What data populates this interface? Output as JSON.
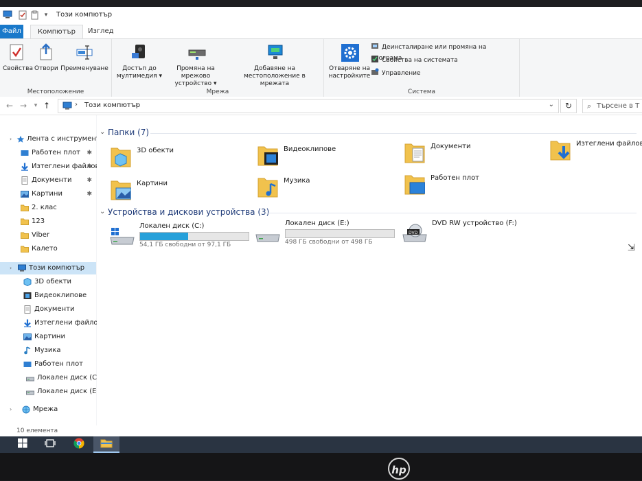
{
  "window": {
    "title": "Този компютър",
    "quick_access_icons": [
      "computer-icon",
      "properties-icon",
      "checkmark-icon",
      "dropdown-icon"
    ]
  },
  "ribbon_tabs": [
    {
      "label": "Файл",
      "state": "file"
    },
    {
      "label": "Компютър",
      "state": "active"
    },
    {
      "label": "Изглед",
      "state": "normal"
    }
  ],
  "ribbon": {
    "location_group": {
      "label": "Местоположение",
      "buttons": [
        {
          "label": "Свойства",
          "icon": "properties-icon"
        },
        {
          "label": "Отвори",
          "icon": "open-icon"
        },
        {
          "label": "Преименуване",
          "icon": "rename-icon"
        }
      ]
    },
    "network_group": {
      "label": "Мрежа",
      "buttons": [
        {
          "label_line1": "Достъп до",
          "label_line2": "мултимедия ▾",
          "icon": "media-access-icon"
        },
        {
          "label_line1": "Промяна на мрежово",
          "label_line2": "устройство ▾",
          "icon": "network-drive-icon"
        },
        {
          "label_line1": "Добавяне на",
          "label_line2": "местоположение в мрежата",
          "icon": "network-location-icon"
        }
      ]
    },
    "system_group": {
      "label": "Система",
      "open_settings_line1": "Отваряне на",
      "open_settings_line2": "настройките",
      "small_buttons": [
        {
          "label": "Деинсталиране или промяна на програма",
          "icon": "uninstall-icon"
        },
        {
          "label": "Свойства на системата",
          "icon": "system-properties-icon"
        },
        {
          "label": "Управление",
          "icon": "manage-icon"
        }
      ]
    }
  },
  "address_bar": {
    "path": "Този компютър",
    "search_placeholder": "Търсене в Т"
  },
  "nav_pane": {
    "quick_access": "Лента с инструменти",
    "items": [
      {
        "label": "Работен плот",
        "icon": "desktop-icon",
        "pinned": true
      },
      {
        "label": "Изтеглени файлове",
        "icon": "download-icon",
        "pinned": true
      },
      {
        "label": "Документи",
        "icon": "documents-icon",
        "pinned": true
      },
      {
        "label": "Картини",
        "icon": "pictures-icon",
        "pinned": true
      },
      {
        "label": "2. клас",
        "icon": "folder-icon",
        "pinned": false
      },
      {
        "label": "123",
        "icon": "folder-icon",
        "pinned": false
      },
      {
        "label": "Viber",
        "icon": "folder-icon",
        "pinned": false
      },
      {
        "label": "Калето",
        "icon": "folder-icon",
        "pinned": false
      }
    ],
    "this_pc": "Този компютър",
    "pc_items": [
      {
        "label": "3D обекти",
        "icon": "3d-objects-icon"
      },
      {
        "label": "Видеоклипове",
        "icon": "videos-icon"
      },
      {
        "label": "Документи",
        "icon": "documents-icon"
      },
      {
        "label": "Изтеглени файлове",
        "icon": "download-icon"
      },
      {
        "label": "Картини",
        "icon": "pictures-icon"
      },
      {
        "label": "Музика",
        "icon": "music-icon"
      },
      {
        "label": "Работен плот",
        "icon": "desktop-icon"
      },
      {
        "label": "Локален диск (C:)",
        "icon": "drive-icon"
      },
      {
        "label": "Локален диск (E:)",
        "icon": "drive-icon"
      }
    ],
    "network": "Мрежа"
  },
  "folders_section": {
    "title": "Папки (7)",
    "folders": [
      {
        "label": "3D обекти",
        "icon": "3d-objects-folder-icon"
      },
      {
        "label": "Видеоклипове",
        "icon": "videos-folder-icon"
      },
      {
        "label": "Документи",
        "icon": "documents-folder-icon"
      },
      {
        "label": "Изтеглени файлове",
        "icon": "downloads-folder-icon"
      },
      {
        "label": "Картини",
        "icon": "pictures-folder-icon"
      },
      {
        "label": "Музика",
        "icon": "music-folder-icon"
      },
      {
        "label": "Работен плот",
        "icon": "desktop-folder-icon"
      }
    ]
  },
  "devices_section": {
    "title": "Устройства и дискови устройства (3)",
    "drives": [
      {
        "label": "Локален диск (C:)",
        "free_text": "54,1 ГБ свободни от 97,1 ГБ",
        "used_fraction": 0.443,
        "icon": "windows-drive-icon",
        "has_bar": true
      },
      {
        "label": "Локален диск (E:)",
        "free_text": "498 ГБ свободни от 498 ГБ",
        "used_fraction": 0.0,
        "icon": "drive-icon",
        "has_bar": true
      },
      {
        "label": "DVD RW устройство (F:)",
        "free_text": "",
        "icon": "dvd-drive-icon",
        "has_bar": false
      }
    ]
  },
  "status_bar": {
    "items_text": "10 елемента"
  },
  "taskbar": {
    "items": [
      {
        "icon": "windows-start-icon",
        "active": false
      },
      {
        "icon": "task-view-icon",
        "active": false
      },
      {
        "icon": "chrome-icon",
        "active": false
      },
      {
        "icon": "file-explorer-icon",
        "active": true
      }
    ]
  },
  "colors": {
    "accent": "#1979ca",
    "progress": "#26a0da",
    "folder": "#f1c24d",
    "selection": "#cce4f7"
  },
  "bezel_logo": "hp"
}
